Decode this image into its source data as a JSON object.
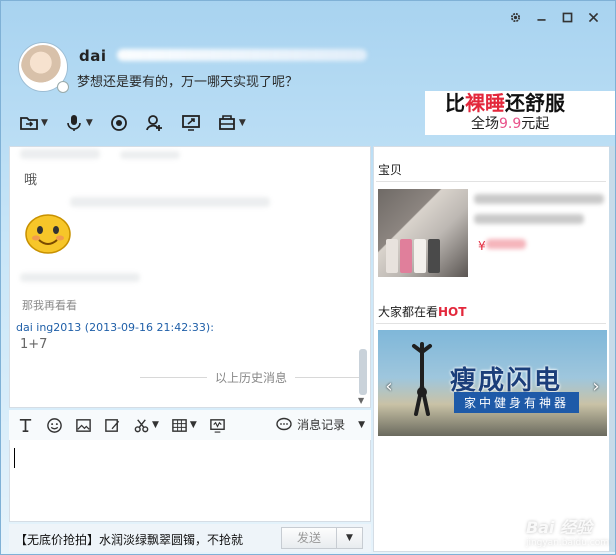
{
  "header": {
    "nickname": "dai",
    "signature": "梦想还是要有的，万一哪天实现了呢？"
  },
  "ad_banner": {
    "line1_a": "比",
    "line1_b": "裸睡",
    "line1_c": "还舒服",
    "line2_a": "全场",
    "line2_b": "9.9",
    "line2_c": "元起"
  },
  "chat": {
    "msg1": "哦",
    "old_text": "那我再看看",
    "sender_name": "dai            ing2013",
    "sender_time": "(2013-09-16 21:42:33):",
    "garbled": "1+7",
    "history_label": "以上历史消息"
  },
  "input_toolbar": {
    "record_label": "消息记录"
  },
  "bottom": {
    "promo_text": "【无底价抢拍】水润淡绿飘翠圆镯，不抢就",
    "send_label": "发送"
  },
  "right_panel": {
    "section1_title": "宝贝",
    "price": "¥",
    "section2_title": "大家都在看",
    "section2_hot": "HOT",
    "video_title": "瘦成闪电",
    "video_sub": "家中健身有神器"
  },
  "watermark": {
    "main": "Bai 经验",
    "sub": "jingyan.baidu.com"
  },
  "colors": {
    "accent_red": "#e3283c",
    "link_blue": "#1f5fa8",
    "banner_blue": "#1b3e7a"
  }
}
